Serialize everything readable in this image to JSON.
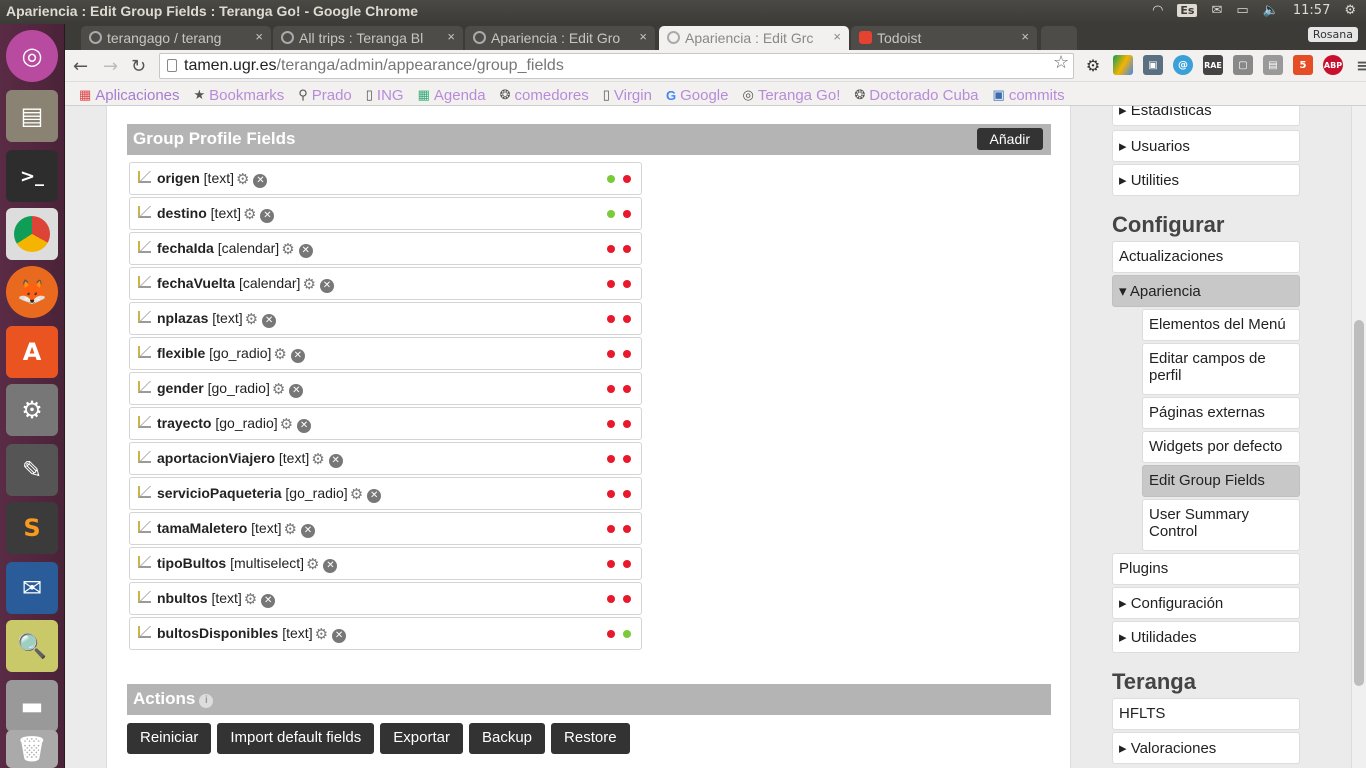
{
  "window_title": "Apariencia : Edit Group Fields : Teranga Go! - Google Chrome",
  "tray": {
    "lang": "Es",
    "time": "11:57"
  },
  "tabs": [
    {
      "label": "terangago / terang",
      "close": "×"
    },
    {
      "label": "All trips : Teranga Bl",
      "close": "×"
    },
    {
      "label": "Apariencia : Edit Gro",
      "close": "×"
    },
    {
      "label": "Apariencia : Edit Grc",
      "close": "×"
    },
    {
      "label": "Todoist",
      "close": "×"
    }
  ],
  "profile": "Rosana",
  "url": {
    "host": "tamen.ugr.es",
    "path": "/teranga/admin/appearance/group_fields"
  },
  "bookmarks": [
    "Aplicaciones",
    "Bookmarks",
    "Prado",
    "ING",
    "Agenda",
    "comedores",
    "Virgin",
    "Google",
    "Teranga Go!",
    "Doctorado Cuba",
    "commits"
  ],
  "main": {
    "section_title": "Group Profile Fields",
    "add_label": "Añadir",
    "fields": [
      {
        "name": "origen",
        "type": "[text]",
        "dots": [
          "green",
          "red"
        ]
      },
      {
        "name": "destino",
        "type": "[text]",
        "dots": [
          "green",
          "red"
        ]
      },
      {
        "name": "fechaIda",
        "type": "[calendar]",
        "dots": [
          "red",
          "red"
        ]
      },
      {
        "name": "fechaVuelta",
        "type": "[calendar]",
        "dots": [
          "red",
          "red"
        ]
      },
      {
        "name": "nplazas",
        "type": "[text]",
        "dots": [
          "red",
          "red"
        ]
      },
      {
        "name": "flexible",
        "type": "[go_radio]",
        "dots": [
          "red",
          "red"
        ]
      },
      {
        "name": "gender",
        "type": "[go_radio]",
        "dots": [
          "red",
          "red"
        ]
      },
      {
        "name": "trayecto",
        "type": "[go_radio]",
        "dots": [
          "red",
          "red"
        ]
      },
      {
        "name": "aportacionViajero",
        "type": "[text]",
        "dots": [
          "red",
          "red"
        ]
      },
      {
        "name": "servicioPaqueteria",
        "type": "[go_radio]",
        "dots": [
          "red",
          "red"
        ]
      },
      {
        "name": "tamaMaletero",
        "type": "[text]",
        "dots": [
          "red",
          "red"
        ]
      },
      {
        "name": "tipoBultos",
        "type": "[multiselect]",
        "dots": [
          "red",
          "red"
        ]
      },
      {
        "name": "nbultos",
        "type": "[text]",
        "dots": [
          "red",
          "red"
        ]
      },
      {
        "name": "bultosDisponibles",
        "type": "[text]",
        "dots": [
          "red",
          "green"
        ]
      }
    ],
    "actions_title": "Actions",
    "actions_info": "i",
    "buttons": [
      "Reiniciar",
      "Import default fields",
      "Exportar",
      "Backup",
      "Restore"
    ]
  },
  "sidebar": {
    "top_items": [
      "▸ Estadísticas",
      "▸ Usuarios",
      "▸ Utilities"
    ],
    "configurar_title": "Configurar",
    "configurar_items": [
      "Actualizaciones",
      "▾ Apariencia"
    ],
    "apariencia_sub": [
      "Elementos del Menú",
      "Editar campos de perfil",
      "Páginas externas",
      "Widgets por defecto",
      "Edit Group Fields",
      "User Summary Control"
    ],
    "bottom_items": [
      "Plugins",
      "▸ Configuración",
      "▸ Utilidades"
    ],
    "teranga_title": "Teranga",
    "teranga_items": [
      "HFLTS",
      "▸ Valoraciones"
    ]
  },
  "colors": {
    "green_dot": "#7cc93a",
    "red_dot": "#e8192c",
    "section_bg": "#b4b4b4",
    "button_bg": "#333333"
  }
}
